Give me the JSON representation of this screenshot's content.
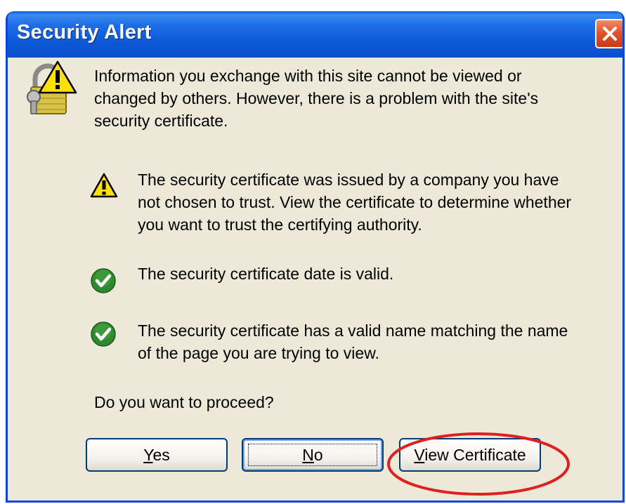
{
  "dialog": {
    "title": "Security Alert",
    "intro_line1": "Information you exchange with this site cannot be viewed or",
    "intro_line2": "changed by others. However, there is a problem with the site's",
    "intro_line3": "security certificate.",
    "items": [
      {
        "status": "warning",
        "icon": "warning-triangle-icon",
        "lines": [
          "The security certificate was issued by a company you have",
          "not chosen to trust. View the certificate to determine whether",
          "you want to trust the certifying authority."
        ]
      },
      {
        "status": "ok",
        "icon": "green-check-icon",
        "lines": [
          "The security certificate date is valid."
        ]
      },
      {
        "status": "ok",
        "icon": "green-check-icon",
        "lines": [
          "The security certificate has a valid name matching the name",
          "of the page you are trying to view."
        ]
      }
    ],
    "question": "Do you want to proceed?",
    "buttons": {
      "yes_mnemonic": "Y",
      "yes_rest": "es",
      "no_mnemonic": "N",
      "no_rest": "o",
      "view_mnemonic": "V",
      "view_rest": "iew Certificate"
    }
  },
  "colors": {
    "titlebar": "#0b57d6",
    "dialog_bg": "#ece9d8",
    "close_button": "#e0502a",
    "warning": "#ffe000",
    "check": "#2f8a2f",
    "highlight": "#e02020"
  }
}
